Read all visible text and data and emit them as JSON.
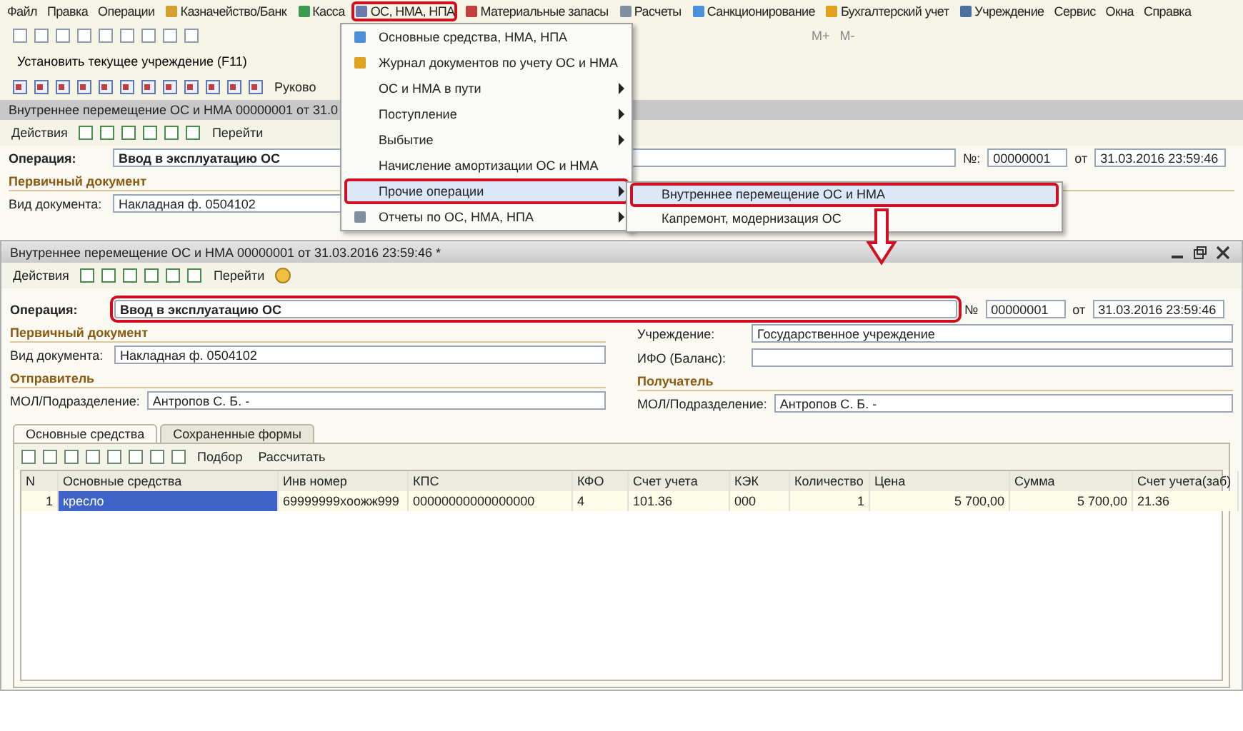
{
  "menu_bar": [
    {
      "label": "Файл",
      "kind": "plain",
      "annotated": false
    },
    {
      "label": "Правка",
      "kind": "plain",
      "annotated": false
    },
    {
      "label": "Операции",
      "kind": "plain",
      "annotated": false
    },
    {
      "label": "Казначейство/Банк",
      "kind": "icon",
      "annotated": false
    },
    {
      "label": "Касса",
      "kind": "icon",
      "annotated": false
    },
    {
      "label": "ОС, НМА, НПА",
      "kind": "icon",
      "annotated": true
    },
    {
      "label": "Материальные запасы",
      "kind": "icon",
      "annotated": false
    },
    {
      "label": "Расчеты",
      "kind": "icon",
      "annotated": false
    },
    {
      "label": "Санкционирование",
      "kind": "icon",
      "annotated": false
    },
    {
      "label": "Бухгалтерский учет",
      "kind": "icon",
      "annotated": false
    },
    {
      "label": "Учреждение",
      "kind": "icon",
      "annotated": false
    },
    {
      "label": "Сервис",
      "kind": "plain",
      "annotated": false
    },
    {
      "label": "Окна",
      "kind": "plain",
      "annotated": false
    },
    {
      "label": "Справка",
      "kind": "plain",
      "annotated": false
    }
  ],
  "toolbar": {
    "calc_buttons": [
      "M+",
      "M-"
    ]
  },
  "institution_button": "Установить текущее учреждение (F11)",
  "guide_button": "Руково",
  "back_window": {
    "title": "Внутреннее перемещение ОС и НМА 00000001 от 31.0",
    "actions": "Действия",
    "goto": "Перейти",
    "operation_label": "Операция:",
    "operation": "Ввод в эксплуатацию ОС",
    "number_label": "№:",
    "number": "00000001",
    "date_label": "от",
    "date": "31.03.2016 23:59:46",
    "section": "Первичный документ",
    "doc_type_label": "Вид документа:",
    "doc_type": "Накладная ф. 0504102"
  },
  "dropdown": {
    "items": [
      {
        "label": "Основные средства, НМА, НПА",
        "kind": "icon",
        "selected": false,
        "annotated": false
      },
      {
        "label": "Журнал документов по учету ОС и НМА",
        "kind": "icon",
        "selected": false,
        "annotated": false
      },
      {
        "label": "ОС и НМА в пути",
        "kind": "submenu",
        "selected": false,
        "annotated": false
      },
      {
        "label": "Поступление",
        "kind": "submenu",
        "selected": false,
        "annotated": false
      },
      {
        "label": "Выбытие",
        "kind": "submenu",
        "selected": false,
        "annotated": false
      },
      {
        "label": "Начисление амортизации ОС и НМА",
        "kind": "plain",
        "selected": false,
        "annotated": false
      },
      {
        "label": "Прочие операции",
        "kind": "submenu",
        "selected": true,
        "annotated": true
      },
      {
        "label": "Отчеты по ОС, НМА, НПА",
        "kind": "icon-submenu",
        "selected": false,
        "annotated": false
      }
    ]
  },
  "submenu": {
    "items": [
      {
        "label": "Внутреннее перемещение ОС и НМА",
        "selected": true,
        "annotated": true
      },
      {
        "label": "Капремонт, модернизация ОС",
        "selected": false,
        "annotated": false
      }
    ]
  },
  "form": {
    "title": "Внутреннее перемещение ОС и НМА 00000001 от 31.03.2016 23:59:46 *",
    "actions": "Действия",
    "goto": "Перейти",
    "operation_label": "Операция:",
    "operation": "Ввод в эксплуатацию ОС",
    "operation_annotated": true,
    "number_label": "№",
    "number": "00000001",
    "date_label": "от",
    "date": "31.03.2016 23:59:46",
    "primary_section": "Первичный документ",
    "doc_type_label": "Вид документа:",
    "doc_type": "Накладная ф. 0504102",
    "institution_label": "Учреждение:",
    "institution": "Государственное учреждение",
    "ifo_label": "ИФО (Баланс):",
    "sender_section": "Отправитель",
    "receiver_section": "Получатель",
    "sender_label": "МОЛ/Подразделение:",
    "sender": "Антропов С. Б. -",
    "receiver_label": "МОЛ/Подразделение:",
    "receiver": "Антропов С. Б. -",
    "tabs": [
      {
        "label": "Основные средства",
        "selected": true
      },
      {
        "label": "Сохраненные формы",
        "selected": false
      }
    ],
    "table_toolbar": {
      "pick": "Подбор",
      "calculate": "Рассчитать"
    },
    "table": {
      "columns": [
        "N",
        "Основные средства",
        "Инв номер",
        "КПС",
        "КФО",
        "Счет учета",
        "КЭК",
        "Количество",
        "Цена",
        "Сумма",
        "Счет учета(заб)"
      ],
      "rows": [
        {
          "cells": [
            {
              "text": "1",
              "selected": false
            },
            {
              "text": "кресло",
              "selected": true
            },
            {
              "text": "69999999хоожж999",
              "selected": false
            },
            {
              "text": "00000000000000000",
              "selected": false
            },
            {
              "text": "4",
              "selected": false
            },
            {
              "text": "101.36",
              "selected": false
            },
            {
              "text": "000",
              "selected": false
            },
            {
              "text": "1",
              "selected": false
            },
            {
              "text": "5 700,00",
              "selected": false
            },
            {
              "text": "5 700,00",
              "selected": false
            },
            {
              "text": "21.36",
              "selected": false
            }
          ]
        }
      ]
    }
  }
}
